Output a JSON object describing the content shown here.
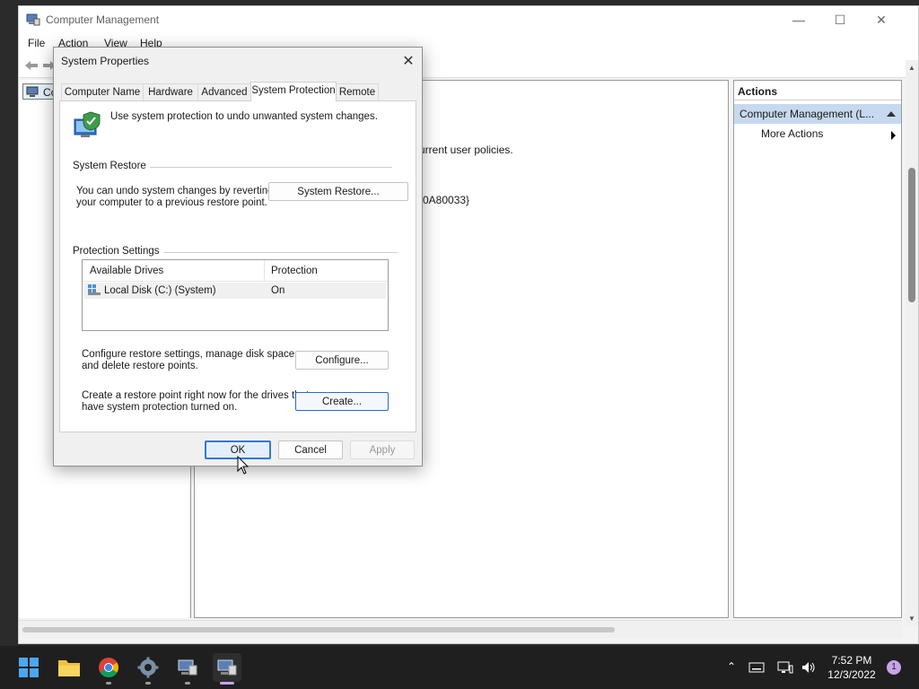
{
  "main_window": {
    "title": "Computer Management",
    "menu": [
      "File",
      "Action",
      "View",
      "Help"
    ],
    "tree_item": "Co",
    "center_text_line1": "urrent user policies.",
    "center_text_line2": ")0A80033}",
    "actions": {
      "header": "Actions",
      "group": "Computer Management (L...",
      "item": "More Actions"
    }
  },
  "dialog": {
    "title": "System Properties",
    "tabs": [
      "Computer Name",
      "Hardware",
      "Advanced",
      "System Protection",
      "Remote"
    ],
    "active_tab": "System Protection",
    "intro": "Use system protection to undo unwanted system changes.",
    "system_restore": {
      "group_label": "System Restore",
      "text_line1": "You can undo system changes by reverting",
      "text_line2": "your computer to a previous restore point.",
      "button": "System Restore..."
    },
    "protection": {
      "group_label": "Protection Settings",
      "columns": [
        "Available Drives",
        "Protection"
      ],
      "rows": [
        {
          "drive": "Local Disk (C:) (System)",
          "protection": "On"
        }
      ],
      "configure_text_line1": "Configure restore settings, manage disk space,",
      "configure_text_line2": "and delete restore points.",
      "configure_button": "Configure...",
      "create_text_line1": "Create a restore point right now for the drives that",
      "create_text_line2": "have system protection turned on.",
      "create_button": "Create..."
    },
    "buttons": {
      "ok": "OK",
      "cancel": "Cancel",
      "apply": "Apply"
    }
  },
  "taskbar": {
    "time": "7:52 PM",
    "date": "12/3/2022",
    "notifications": "1",
    "apps": [
      "start-icon",
      "file-explorer-icon",
      "chrome-icon",
      "settings-icon",
      "system-properties-icon",
      "computer-management-icon"
    ]
  },
  "colors": {
    "accent": "#3477d3",
    "selection": "#c6d9ef",
    "taskbar": "#1f1f1f"
  }
}
